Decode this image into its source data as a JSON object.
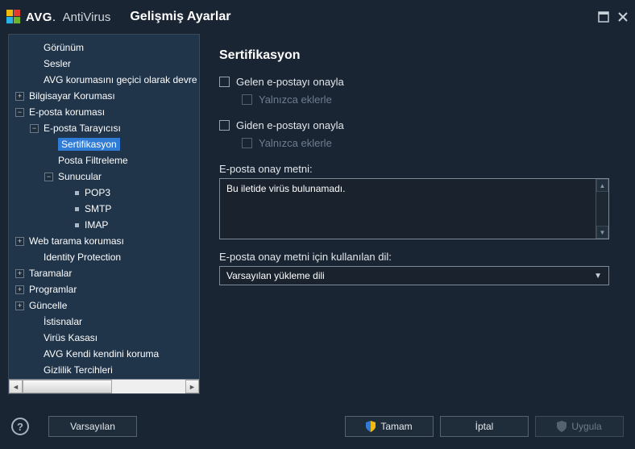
{
  "header": {
    "brand_bold": "AVG",
    "brand_rest": "AntiVirus",
    "title": "Gelişmiş Ayarlar"
  },
  "tree": {
    "items": [
      {
        "indent": 1,
        "expand": "",
        "leaf": false,
        "label": "Görünüm"
      },
      {
        "indent": 1,
        "expand": "",
        "leaf": false,
        "label": "Sesler"
      },
      {
        "indent": 1,
        "expand": "",
        "leaf": false,
        "label": "AVG korumasını geçici olarak devre dışı bırak"
      },
      {
        "indent": 0,
        "expand": "+",
        "leaf": false,
        "label": "Bilgisayar Koruması"
      },
      {
        "indent": 0,
        "expand": "-",
        "leaf": false,
        "label": "E-posta koruması"
      },
      {
        "indent": 1,
        "expand": "-",
        "leaf": false,
        "label": "E-posta Tarayıcısı"
      },
      {
        "indent": 2,
        "expand": "",
        "leaf": false,
        "label": "Sertifikasyon",
        "selected": true
      },
      {
        "indent": 2,
        "expand": "",
        "leaf": false,
        "label": "Posta Filtreleme"
      },
      {
        "indent": 2,
        "expand": "-",
        "leaf": false,
        "label": "Sunucular"
      },
      {
        "indent": 3,
        "expand": "",
        "leaf": true,
        "label": "POP3"
      },
      {
        "indent": 3,
        "expand": "",
        "leaf": true,
        "label": "SMTP"
      },
      {
        "indent": 3,
        "expand": "",
        "leaf": true,
        "label": "IMAP"
      },
      {
        "indent": 0,
        "expand": "+",
        "leaf": false,
        "label": "Web tarama koruması"
      },
      {
        "indent": 1,
        "expand": "",
        "leaf": false,
        "label": "Identity Protection"
      },
      {
        "indent": 0,
        "expand": "+",
        "leaf": false,
        "label": "Taramalar"
      },
      {
        "indent": 0,
        "expand": "+",
        "leaf": false,
        "label": "Programlar"
      },
      {
        "indent": 0,
        "expand": "+",
        "leaf": false,
        "label": "Güncelle"
      },
      {
        "indent": 1,
        "expand": "",
        "leaf": false,
        "label": "İstisnalar"
      },
      {
        "indent": 1,
        "expand": "",
        "leaf": false,
        "label": "Virüs Kasası"
      },
      {
        "indent": 1,
        "expand": "",
        "leaf": false,
        "label": "AVG Kendi kendini koruma"
      },
      {
        "indent": 1,
        "expand": "",
        "leaf": false,
        "label": "Gizlilik Tercihleri"
      }
    ]
  },
  "content": {
    "title": "Sertifikasyon",
    "check_incoming": "Gelen e-postayı onayla",
    "check_incoming_sub": "Yalnızca eklerle",
    "check_outgoing": "Giden e-postayı onayla",
    "check_outgoing_sub": "Yalnızca eklerle",
    "approval_text_label": "E-posta onay metni:",
    "approval_text_value": "Bu iletide virüs bulunamadı.",
    "language_label": "E-posta onay metni için kullanılan dil:",
    "language_value": "Varsayılan yükleme dili"
  },
  "footer": {
    "default": "Varsayılan",
    "ok": "Tamam",
    "cancel": "İptal",
    "apply": "Uygula"
  }
}
